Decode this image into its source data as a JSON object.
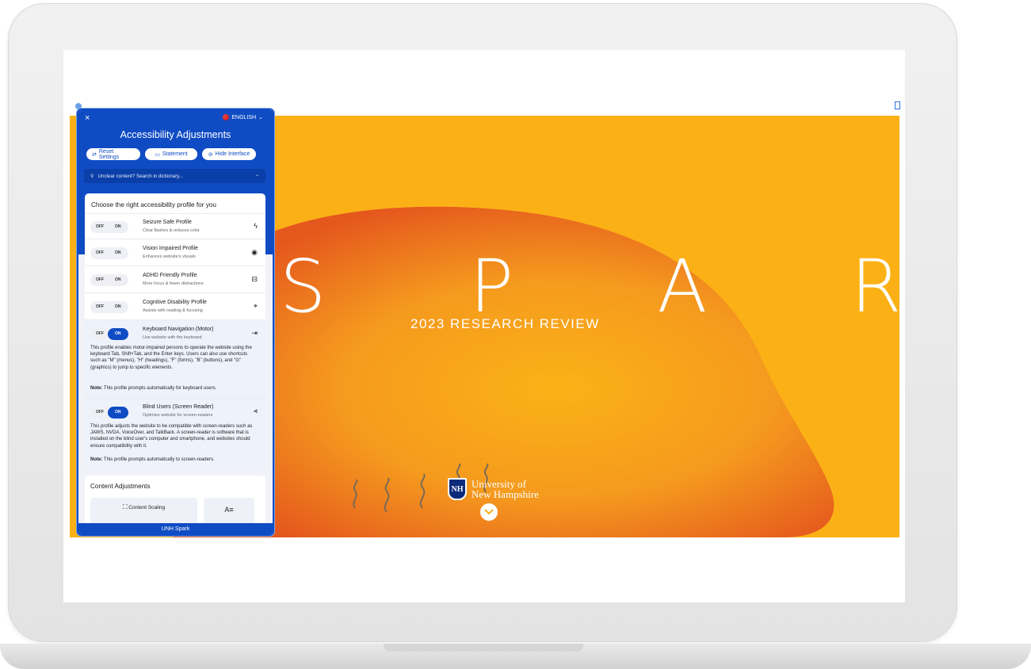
{
  "hero": {
    "title": "S P A R K",
    "subtitle": "2023 RESEARCH REVIEW",
    "logo_line1": "University of",
    "logo_line2": "New Hampshire",
    "logo_mark": "NH",
    "scroll_icon": "chevron-down-icon",
    "background_color": "#fbb116",
    "blob_color": "#e8641f"
  },
  "panel": {
    "close_label": "×",
    "language": "ENGLISH",
    "title": "Accessibility Adjustments",
    "buttons": [
      {
        "label": "Reset Settings",
        "icon": "reset-icon"
      },
      {
        "label": "Statement",
        "icon": "statement-icon"
      },
      {
        "label": "Hide Interface",
        "icon": "hide-icon"
      }
    ],
    "search_placeholder": "Unclear content? Search in dictionary...",
    "profiles_heading": "Choose the right accessibility profile for you",
    "toggle_off": "OFF",
    "toggle_on": "ON",
    "profiles": [
      {
        "name": "Seizure Safe Profile",
        "desc": "Clear flashes & reduces color",
        "icon": "lightning-icon",
        "active": false
      },
      {
        "name": "Vision Impaired Profile",
        "desc": "Enhances website's visuals",
        "icon": "eye-icon",
        "active": false
      },
      {
        "name": "ADHD Friendly Profile",
        "desc": "More focus & fewer distractions",
        "icon": "focus-icon",
        "active": false
      },
      {
        "name": "Cognitive Disability Profile",
        "desc": "Assists with reading & focusing",
        "icon": "target-icon",
        "active": false
      },
      {
        "name": "Keyboard Navigation (Motor)",
        "desc": "Use website with the keyboard",
        "icon": "arrow-right-icon",
        "active": true,
        "details": "This profile enables motor-impaired persons to operate the website using the keyboard Tab, Shift+Tab, and the Enter keys. Users can also use shortcuts such as \"M\" (menus), \"H\" (headings), \"F\" (forms), \"B\" (buttons), and \"G\" (graphics) to jump to specific elements.",
        "note_label": "Note:",
        "note": "This profile prompts automatically for keyboard users."
      },
      {
        "name": "Blind Users (Screen Reader)",
        "desc": "Optimize website for screen-readers",
        "icon": "audio-icon",
        "active": true,
        "details": "This profile adjusts the website to be compatible with screen-readers such as JAWS, NVDA, VoiceOver, and TalkBack. A screen-reader is software that is installed on the blind user's computer and smartphone, and websites should ensure compatibility with it.",
        "note_label": "Note:",
        "note": "This profile prompts automatically to screen-readers."
      }
    ],
    "content_heading": "Content Adjustments",
    "content_scaling": "Content Scaling",
    "text_icon": "A≡",
    "footer": "UNH Spark",
    "accent_color": "#0f4cc4"
  }
}
